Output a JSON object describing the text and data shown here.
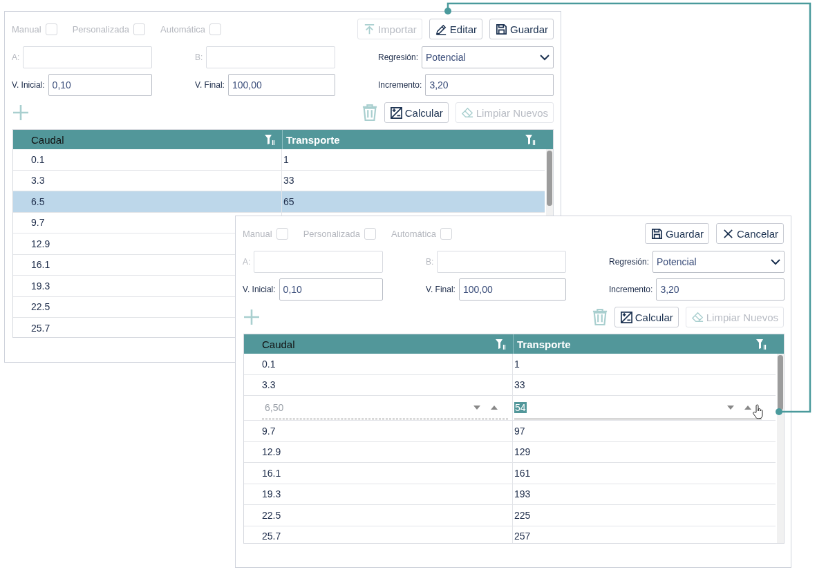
{
  "panels": [
    {
      "checkboxes": [
        {
          "label": "Manual",
          "checked": false,
          "disabled": true
        },
        {
          "label": "Personalizada",
          "checked": false,
          "disabled": true
        },
        {
          "label": "Automática",
          "checked": false,
          "disabled": true
        }
      ],
      "buttons": [
        {
          "kind": "import",
          "label": "Importar",
          "disabled": true
        },
        {
          "kind": "edit",
          "label": "Editar",
          "disabled": false
        },
        {
          "kind": "save",
          "label": "Guardar",
          "disabled": false
        }
      ],
      "fields": [
        {
          "kind": "text",
          "label": "A:",
          "disabled": true
        },
        {
          "kind": "text",
          "label": "B:",
          "disabled": true
        },
        {
          "kind": "select",
          "label": "Regresión:",
          "value": "Potencial",
          "disabled": false
        },
        {
          "kind": "text",
          "label": "V. Inicial:",
          "value": "0,10",
          "disabled": false
        },
        {
          "kind": "text",
          "label": "V. Final:",
          "value": "100,00",
          "disabled": false
        },
        {
          "kind": "text",
          "label": "Incremento:",
          "value": "3,20",
          "disabled": false
        }
      ],
      "actions": [
        {
          "kind": "calculate",
          "label": "Calcular",
          "disabled": false
        },
        {
          "kind": "clear",
          "label": "Limpiar Nuevos",
          "disabled": true
        }
      ],
      "table": {
        "columns": [
          {
            "label": "Caudal",
            "selected": true
          },
          {
            "label": "Transporte",
            "selected": false
          }
        ],
        "rows": [
          {
            "kind": "view",
            "caudal": "0.1",
            "transporte": "1",
            "selected": false
          },
          {
            "kind": "view",
            "caudal": "3.3",
            "transporte": "33",
            "selected": false
          },
          {
            "kind": "view",
            "caudal": "6.5",
            "transporte": "65",
            "selected": true
          },
          {
            "kind": "view",
            "caudal": "9.7",
            "selected": false
          },
          {
            "kind": "view",
            "caudal": "12.9",
            "selected": false
          },
          {
            "kind": "view",
            "caudal": "16.1",
            "selected": false
          },
          {
            "kind": "view",
            "caudal": "19.3",
            "selected": false
          },
          {
            "kind": "view",
            "caudal": "22.5",
            "selected": false
          },
          {
            "kind": "view",
            "caudal": "25.7",
            "selected": false
          }
        ]
      }
    },
    {
      "checkboxes": [
        {
          "label": "Manual",
          "checked": false,
          "disabled": true
        },
        {
          "label": "Personalizada",
          "checked": false,
          "disabled": true
        },
        {
          "label": "Automática",
          "checked": false,
          "disabled": true
        }
      ],
      "buttons": [
        {
          "kind": "save",
          "label": "Guardar",
          "disabled": false
        },
        {
          "kind": "cancel",
          "label": "Cancelar",
          "disabled": false
        }
      ],
      "fields": [
        {
          "kind": "text",
          "label": "A:",
          "disabled": true
        },
        {
          "kind": "text",
          "label": "B:",
          "disabled": true
        },
        {
          "kind": "select",
          "label": "Regresión:",
          "value": "Potencial",
          "disabled": false
        },
        {
          "kind": "text",
          "label": "V. Inicial:",
          "value": "0,10",
          "disabled": false
        },
        {
          "kind": "text",
          "label": "V. Final:",
          "value": "100,00",
          "disabled": false
        },
        {
          "kind": "text",
          "label": "Incremento:",
          "value": "3,20",
          "disabled": false
        }
      ],
      "actions": [
        {
          "kind": "calculate",
          "label": "Calcular",
          "disabled": false
        },
        {
          "kind": "clear",
          "label": "Limpiar Nuevos",
          "disabled": true
        }
      ],
      "table": {
        "columns": [
          {
            "label": "Caudal",
            "selected": true
          },
          {
            "label": "Transporte",
            "selected": false
          }
        ],
        "rows": [
          {
            "kind": "view",
            "caudal": "0.1",
            "transporte": "1",
            "selected": false
          },
          {
            "kind": "view",
            "caudal": "3.3",
            "transporte": "33",
            "selected": false
          },
          {
            "kind": "edit",
            "caudal": "6,50",
            "transporte": "54",
            "selected": false
          },
          {
            "kind": "view",
            "caudal": "9.7",
            "transporte": "97",
            "selected": false
          },
          {
            "kind": "view",
            "caudal": "12.9",
            "transporte": "129",
            "selected": false
          },
          {
            "kind": "view",
            "caudal": "16.1",
            "transporte": "161",
            "selected": false
          },
          {
            "kind": "view",
            "caudal": "19.3",
            "transporte": "193",
            "selected": false
          },
          {
            "kind": "view",
            "caudal": "22.5",
            "transporte": "225",
            "selected": false
          },
          {
            "kind": "view",
            "caudal": "25.7",
            "transporte": "257",
            "selected": false
          }
        ]
      }
    }
  ]
}
